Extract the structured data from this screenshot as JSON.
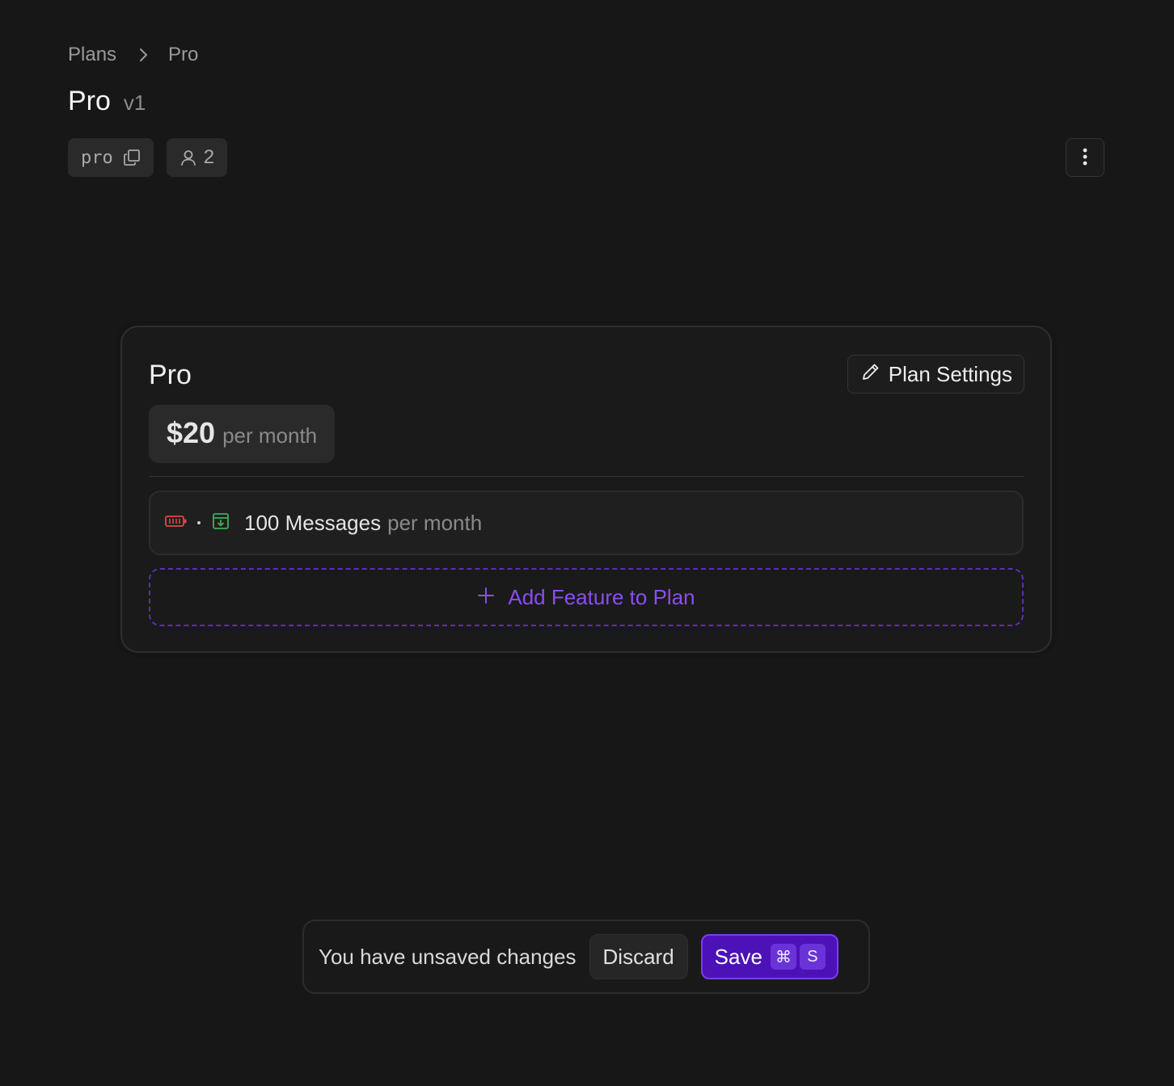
{
  "breadcrumb": {
    "items": [
      "Plans",
      "Pro"
    ],
    "separator_icon": "chevron-right-icon"
  },
  "header": {
    "title": "Pro",
    "version": "v1",
    "plan_id": "pro",
    "copy_icon": "copy-icon",
    "customers_icon": "user-icon",
    "customer_count": "2",
    "more_icon": "more-vertical-icon"
  },
  "card": {
    "title": "Pro",
    "settings_label": "Plan Settings",
    "settings_icon": "pencil-icon",
    "price": {
      "amount": "$20",
      "period": "per month"
    },
    "features": [
      {
        "icons": [
          "battery-icon",
          "archive-download-icon"
        ],
        "label": "100 Messages",
        "unit": "per month"
      }
    ],
    "add_feature_label": "Add Feature to Plan",
    "add_icon": "plus-icon"
  },
  "unsaved_bar": {
    "message": "You have unsaved changes",
    "discard_label": "Discard",
    "save_label": "Save",
    "shortcut_keys": [
      "⌘",
      "S"
    ]
  },
  "colors": {
    "background": "#171717",
    "accent": "#8b4df0",
    "save_button": "#4c12b8",
    "battery_icon": "#e04848",
    "archive_icon": "#3fae5a"
  }
}
